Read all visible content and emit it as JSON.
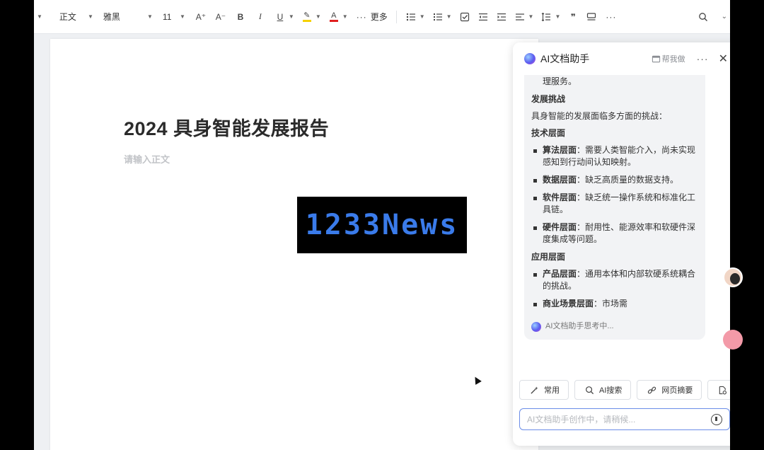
{
  "toolbar": {
    "style_label": "正文",
    "font_label": "雅黑",
    "size_label": "11",
    "more_label": "更多"
  },
  "document": {
    "title": "2024 具身智能发展报告",
    "placeholder": "请输入正文",
    "banner_text": "1233News"
  },
  "ai_panel": {
    "title": "AI文档助手",
    "help_label": "帮我做",
    "content": {
      "top_item": "应对老龄化问题，提供个性化的康复和护理服务。",
      "section_challenge": "发展挑战",
      "challenge_intro": "具身智能的发展面临多方面的挑战：",
      "section_tech": "技术层面",
      "tech_items": [
        {
          "label": "算法层面",
          "text": "：需要人类智能介入，尚未实现感知到行动间认知映射。"
        },
        {
          "label": "数据层面",
          "text": "：缺乏高质量的数据支持。"
        },
        {
          "label": "软件层面",
          "text": "：缺乏统一操作系统和标准化工具链。"
        },
        {
          "label": "硬件层面",
          "text": "：耐用性、能源效率和软硬件深度集成等问题。"
        }
      ],
      "section_app": "应用层面",
      "app_items": [
        {
          "label": "产品层面",
          "text": "：通用本体和内部软硬系统耦合的挑战。"
        },
        {
          "label": "商业场景层面",
          "text": "：市场需"
        }
      ]
    },
    "thinking_text": "AI文档助手思考中...",
    "chips": [
      "常用",
      "AI搜索",
      "网页摘要",
      "文档"
    ],
    "input_placeholder": "AI文档助手创作中，请稍候..."
  },
  "colors": {
    "accent": "#3a7bea",
    "input_border": "#6b8de8",
    "highlight_yellow": "#f5d100",
    "font_red": "#e02020"
  }
}
